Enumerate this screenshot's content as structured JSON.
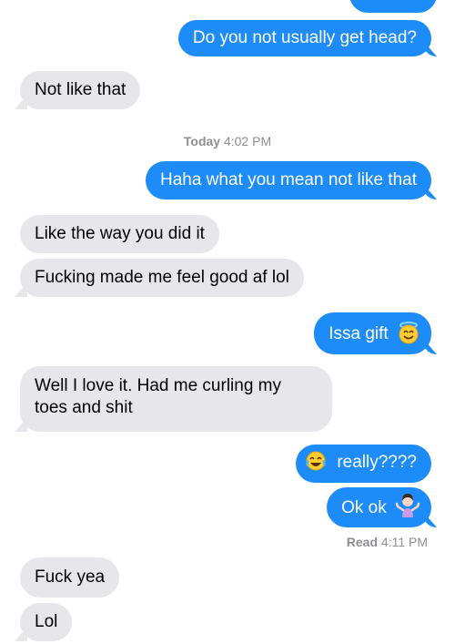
{
  "messages": [
    {
      "text": "Do you not usually get head?"
    },
    {
      "text": "Not like that"
    },
    {
      "text": "Haha what you mean not like that"
    },
    {
      "text": "Like the way you did it"
    },
    {
      "text": "Fucking made me feel good af lol"
    },
    {
      "text": "Issa gift"
    },
    {
      "text": "Well I love it. Had me curling my toes and shit"
    },
    {
      "text": "really????"
    },
    {
      "text": "Ok ok"
    },
    {
      "text": "Fuck yea"
    },
    {
      "text": "Lol"
    }
  ],
  "timestamp": {
    "day": "Today",
    "time": "4:02 PM"
  },
  "read_receipt": {
    "label": "Read",
    "time": "4:11 PM"
  },
  "icons": {
    "halo": "smiling-face-with-halo-icon",
    "tears_of_joy": "face-with-tears-of-joy-icon",
    "shrug": "person-shrugging-icon"
  },
  "colors": {
    "outgoing": "#1e8cf8",
    "incoming": "#e6e6eb",
    "meta": "#8e8e93"
  }
}
